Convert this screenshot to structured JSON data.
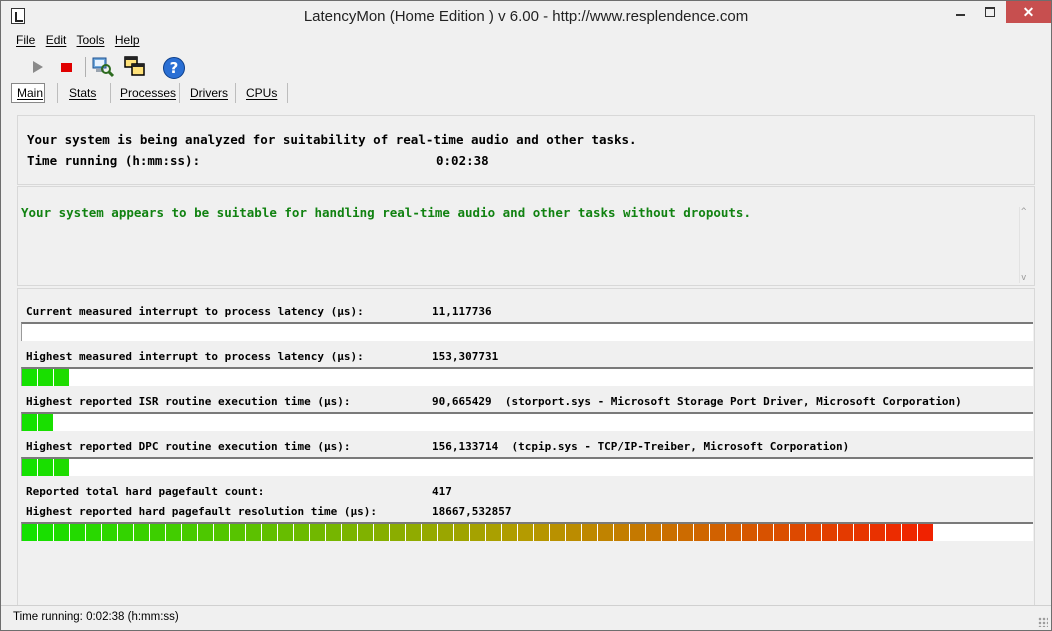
{
  "window": {
    "title": "LatencyMon  (Home Edition )  v 6.00 - http://www.resplendence.com",
    "close_glyph": "✕"
  },
  "menu": [
    {
      "label": "File"
    },
    {
      "label": "Edit"
    },
    {
      "label": "Tools"
    },
    {
      "label": "Help"
    }
  ],
  "toolbar": {
    "icons": [
      "play-icon",
      "stop-icon",
      "magnify-icon",
      "windows-icon",
      "help-icon"
    ],
    "help_glyph": "?"
  },
  "tabs": [
    {
      "label": "Main"
    },
    {
      "label": "Stats"
    },
    {
      "label": "Processes"
    },
    {
      "label": "Drivers"
    },
    {
      "label": "CPUs"
    }
  ],
  "analysis": {
    "line1": "Your system is being analyzed for suitability of real-time audio and other tasks.",
    "time_label": "Time running (h:mm:ss):",
    "time_value": "0:02:38"
  },
  "conclusion": {
    "message": "Your system appears to be suitable for handling real-time audio and other tasks without dropouts.",
    "color": "#118211",
    "scroll_up": "^",
    "scroll_down": "v"
  },
  "metrics": [
    {
      "label": "Current measured interrupt to process latency (µs):",
      "value": "11,117736",
      "bar_segments": 0
    },
    {
      "label": "Highest measured interrupt to process latency (µs):",
      "value": "153,307731",
      "bar_segments": 3
    },
    {
      "label": "Highest reported ISR routine execution time (µs):",
      "value": "90,665429  (storport.sys - Microsoft Storage Port Driver, Microsoft Corporation)",
      "bar_segments": 2
    },
    {
      "label": "Highest reported DPC routine execution time (µs):",
      "value": "156,133714  (tcpip.sys - TCP/IP-Treiber, Microsoft Corporation)",
      "bar_segments": 3
    },
    {
      "label": "Reported total hard pagefault count:",
      "value": "417"
    },
    {
      "label": "Highest reported hard pagefault resolution time (µs):",
      "value": "18667,532857",
      "bar_segments": 57
    }
  ],
  "bar_total_segments": 63,
  "status": {
    "text": "Time running: 0:02:38  (h:mm:ss)"
  }
}
